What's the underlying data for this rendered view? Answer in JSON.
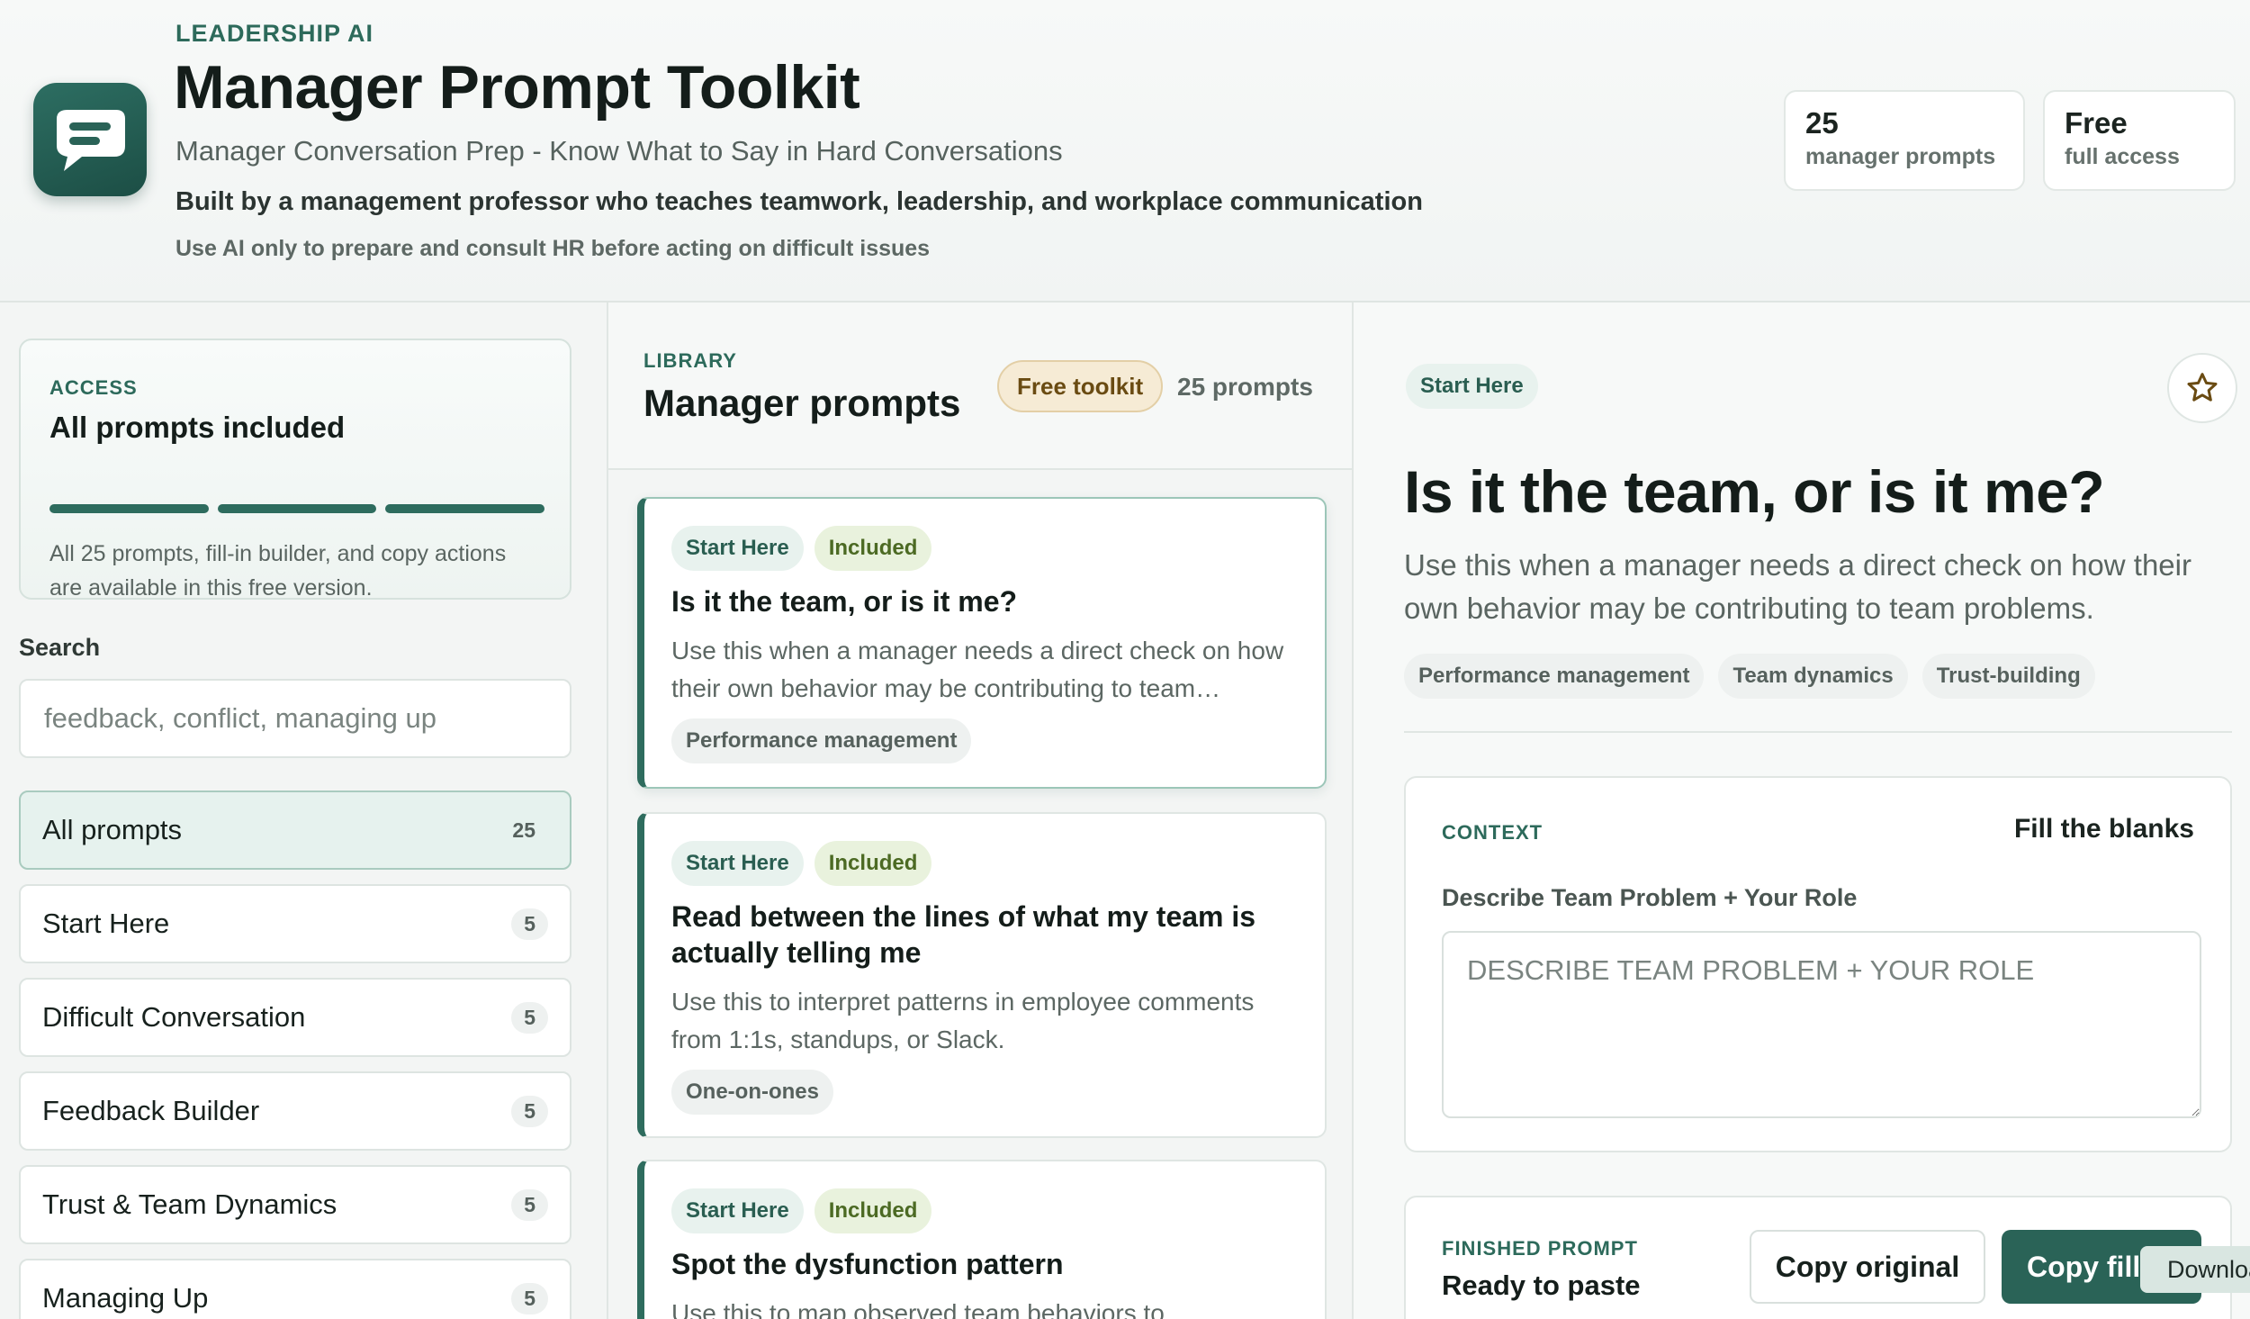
{
  "header": {
    "eyebrow": "LEADERSHIP AI",
    "title": "Manager Prompt Toolkit",
    "subtitle": "Manager Conversation Prep - Know What to Say in Hard Conversations",
    "byline": "Built by a management professor who teaches teamwork, leadership, and workplace communication",
    "disclaimer": "Use AI only to prepare and consult HR before acting on difficult issues",
    "logo_icon": "chat-bubble-icon",
    "stats": [
      {
        "value": "25",
        "label": "manager prompts"
      },
      {
        "value": "Free",
        "label": "full access"
      }
    ]
  },
  "sidebar": {
    "access": {
      "kicker": "ACCESS",
      "title": "All prompts included",
      "progress_segments_filled": 3,
      "progress_segments_total": 3,
      "description": "All 25 prompts, fill-in builder, and copy actions are available in this free version."
    },
    "search": {
      "label": "Search",
      "placeholder": "feedback, conflict, managing up",
      "value": ""
    },
    "categories": [
      {
        "name": "All prompts",
        "count": "25",
        "active": true
      },
      {
        "name": "Start Here",
        "count": "5"
      },
      {
        "name": "Difficult Conversation",
        "count": "5"
      },
      {
        "name": "Feedback Builder",
        "count": "5"
      },
      {
        "name": "Trust & Team Dynamics",
        "count": "5"
      },
      {
        "name": "Managing Up",
        "count": "5"
      }
    ]
  },
  "library": {
    "kicker": "LIBRARY",
    "title": "Manager prompts",
    "badge": "Free toolkit",
    "count_text": "25 prompts",
    "prompts": [
      {
        "category": "Start Here",
        "status": "Included",
        "title": "Is it the team, or is it me?",
        "description": "Use this when a manager needs a direct check on how their own behavior may be contributing to team problems.",
        "topic": "Performance management"
      },
      {
        "category": "Start Here",
        "status": "Included",
        "title": "Read between the lines of what my team is actually telling me",
        "description": "Use this to interpret patterns in employee comments from 1:1s, standups, or Slack.",
        "topic": "One-on-ones"
      },
      {
        "category": "Start Here",
        "status": "Included",
        "title": "Spot the dysfunction pattern",
        "description": "Use this to map observed team behaviors to",
        "topic": ""
      }
    ]
  },
  "detail": {
    "category": "Start Here",
    "favorite_icon": "star-outline-icon",
    "title": "Is it the team, or is it me?",
    "description": "Use this when a manager needs a direct check on how their own behavior may be contributing to team problems.",
    "tags": [
      "Performance management",
      "Team dynamics",
      "Trust-building"
    ],
    "context": {
      "kicker": "CONTEXT",
      "mode": "Fill the blanks",
      "field_label": "Describe Team Problem + Your Role",
      "field_placeholder": "DESCRIBE TEAM PROBLEM + YOUR ROLE"
    },
    "finished": {
      "kicker": "FINISHED PROMPT",
      "status": "Ready to paste",
      "copy_original": "Copy original",
      "copy_filled": "Copy filled",
      "tooltip": "Download"
    }
  },
  "colors": {
    "accent": "#2e6c5e",
    "accent_dark": "#2a6357",
    "badge_bg": "#f6ebd5",
    "included_bg": "#e9f2dd"
  }
}
